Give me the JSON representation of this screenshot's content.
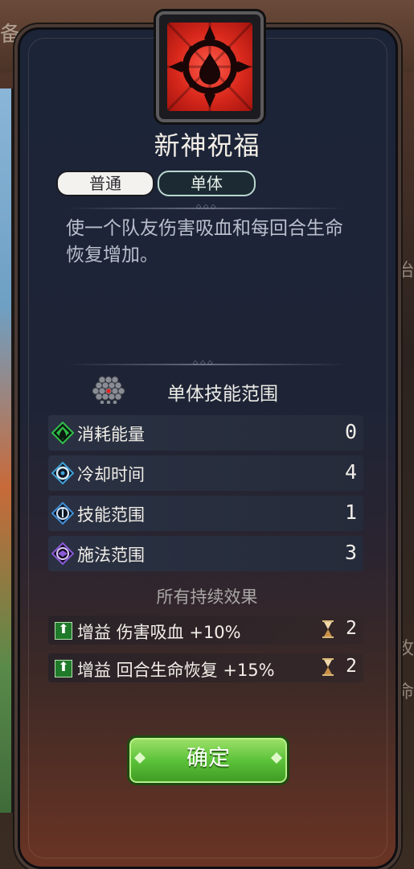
{
  "background": {
    "topbar_left": "备",
    "topbar_mid": "◇  ◇",
    "right_text_1": "治",
    "right_text_2": "攻",
    "right_text_3": "命"
  },
  "skill": {
    "name": "新神祝福",
    "tags": [
      "普通",
      "单体"
    ],
    "description": "使一个队友伤害吸血和每回合生命恢复增加。",
    "range_label": "单体技能范围",
    "stats": [
      {
        "label": "消耗能量",
        "value": "0",
        "icon": "energy-icon",
        "color": "#2fbf4a"
      },
      {
        "label": "冷却时间",
        "value": "4",
        "icon": "cooldown-icon",
        "color": "#3fa0d8"
      },
      {
        "label": "技能范围",
        "value": "1",
        "icon": "skill-range-icon",
        "color": "#3f8fd8"
      },
      {
        "label": "施法范围",
        "value": "3",
        "icon": "cast-range-icon",
        "color": "#8a5ad8"
      }
    ],
    "effects_title": "所有持续效果",
    "effects": [
      {
        "text": "增益 伤害吸血 +10%",
        "turns": "2"
      },
      {
        "text": "增益 回合生命恢复 +15%",
        "turns": "2"
      }
    ]
  },
  "confirm_label": "确定",
  "colors": {
    "skill_icon": "#d8281c",
    "confirm_green": "#5cc23a",
    "buff_green": "#1f7a2a"
  }
}
